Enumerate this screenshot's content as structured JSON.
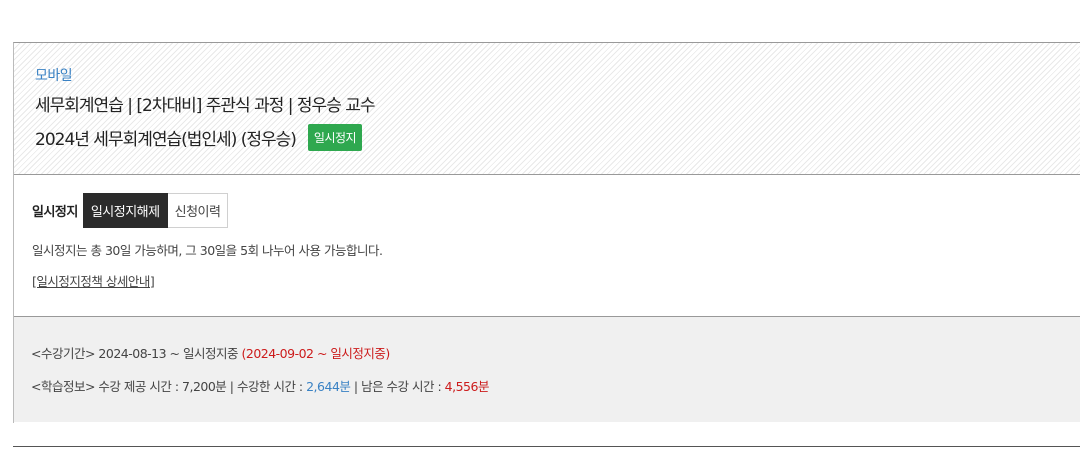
{
  "header": {
    "device": "모바일",
    "course": "세무회계연습 | [2차대비] 주관식 과정 | 정우승 교수",
    "title": "2024년 세무회계연습(법인세) (정우승)",
    "status_badge": "일시정지"
  },
  "pause": {
    "label": "일시정지",
    "tabs": [
      {
        "label": "일시정지해제",
        "active": true
      },
      {
        "label": "신청이력",
        "active": false
      }
    ],
    "description": "일시정지는 총 30일 가능하며, 그 30일을 5회 나누어 사용 가능합니다.",
    "policy_link": "[일시정지정책 상세안내]"
  },
  "info": {
    "period_prefix": "<수강기간> 2024-08-13 ~ 일시정지중",
    "period_pause": "(2024-09-02 ~ 일시정지중)",
    "study_prefix": "<학습정보> 수강 제공 시간 : 7,200분 | 수강한 시간 : ",
    "study_used": "2,644분",
    "study_mid": " | 남은 수강 시간 : ",
    "study_remaining": "4,556분"
  },
  "colors": {
    "accent_blue": "#3a82c4",
    "badge_green": "#2fa84f",
    "alert_red": "#cc1b1b"
  }
}
